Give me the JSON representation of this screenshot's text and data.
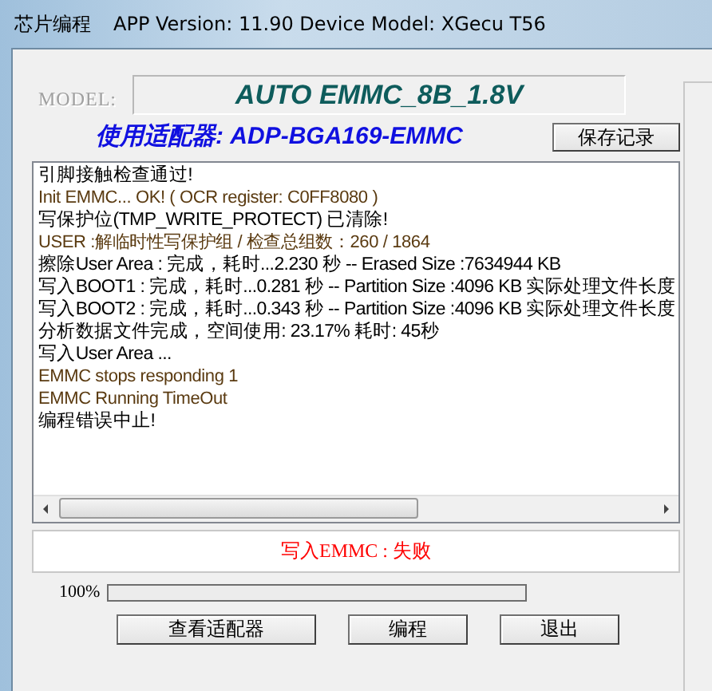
{
  "window": {
    "title": "芯片编程",
    "subtitle": "APP Version: 11.90 Device Model: XGecu T56"
  },
  "model": {
    "label": "MODEL:",
    "value": "AUTO EMMC_8B_1.8V"
  },
  "adapter": "使用适配器: ADP-BGA169-EMMC",
  "save_button": "保存记录",
  "log": [
    {
      "kind": "main",
      "text": "引脚接触检查通过!"
    },
    {
      "kind": "detail",
      "text": "Init EMMC... OK!    ( OCR register: C0FF8080 )"
    },
    {
      "kind": "main",
      "text": "写保护位(TMP_WRITE_PROTECT) 已清除!"
    },
    {
      "kind": "detail",
      "text": "USER :解临时性写保护组 / 检查总组数：260 / 1864"
    },
    {
      "kind": "main",
      "text": "擦除User Area : 完成，耗时...2.230 秒 -- Erased Size :7634944 KB"
    },
    {
      "kind": "main",
      "text": "写入BOOT1 : 完成，耗时...0.281 秒 -- Partition Size :4096 KB 实际处理文件长度"
    },
    {
      "kind": "main",
      "text": "写入BOOT2 : 完成，耗时...0.343 秒 -- Partition Size :4096 KB 实际处理文件长度"
    },
    {
      "kind": "main",
      "text": "分析数据文件完成，空间使用: 23.17%   耗时: 45秒"
    },
    {
      "kind": "main",
      "text": "写入User Area ..."
    },
    {
      "kind": "detail",
      "text": "EMMC stops responding 1"
    },
    {
      "kind": "detail",
      "text": "EMMC Running TimeOut"
    },
    {
      "kind": "main",
      "text": "编程错误中止!"
    }
  ],
  "status": "写入EMMC : 失败",
  "progress": {
    "reading": "100%",
    "level": 0
  },
  "buttons": [
    "查看适配器",
    "编程",
    "退出"
  ]
}
